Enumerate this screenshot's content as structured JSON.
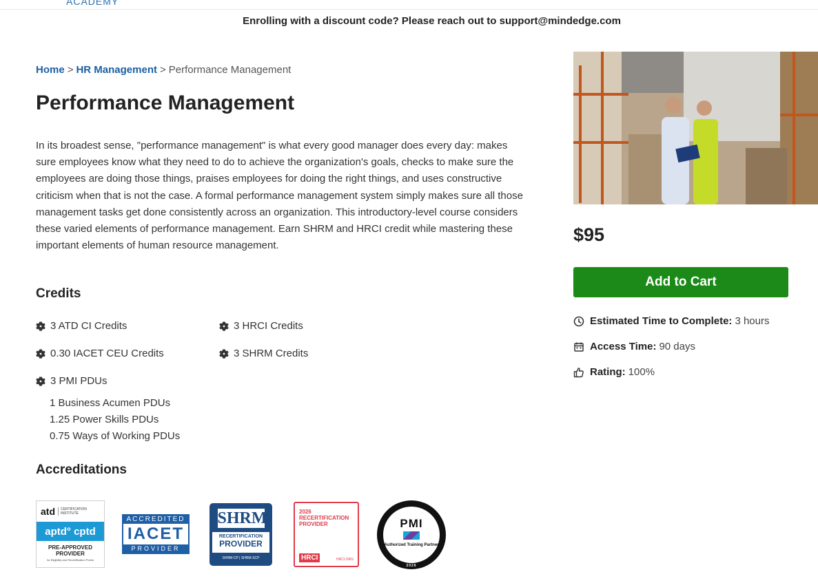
{
  "notice": "Enrolling with a discount code? Please reach out to support@mindedge.com",
  "breadcrumb": {
    "home": "Home",
    "separator": ">",
    "category": "HR Management",
    "current": "Performance Management"
  },
  "title": "Performance Management",
  "description": "In its broadest sense, \"performance management\" is what every good manager does every day: makes sure employees know what they need to do to achieve the organization's goals, checks to make sure the employees are doing those things, praises employees for doing the right things, and uses constructive criticism when that is not the case. A formal performance management system simply makes sure all those management tasks get done consistently across an organization. This introductory-level course considers these varied elements of performance management. Earn SHRM and HRCI credit while mastering these important elements of human resource management.",
  "credits": {
    "heading": "Credits",
    "items": [
      "3 ATD CI Credits",
      "3 HRCI Credits",
      "0.30 IACET CEU Credits",
      "3 SHRM Credits",
      "3 PMI PDUs"
    ],
    "pdu_breakdown": [
      "1 Business Acumen PDUs",
      "1.25 Power Skills PDUs",
      "0.75 Ways of Working PDUs"
    ]
  },
  "accreditations": {
    "heading": "Accreditations",
    "badges": {
      "atd": {
        "brand": "atd",
        "institute": "CERTIFICATION INSTITUTE",
        "marks": "aptd° cptd",
        "label": "PRE-APPROVED PROVIDER",
        "fine_print": "for Eligibility and Recertification Points"
      },
      "iacet": {
        "top": "ACCREDITED",
        "name": "IACET",
        "bottom": "PROVIDER"
      },
      "shrm": {
        "logo": "SHRM",
        "line1": "RECERTIFICATION",
        "line2": "PROVIDER",
        "foot": "SHRM-CP | SHRM-SCP"
      },
      "hrci": {
        "line1": "2026",
        "line2": "RECERTIFICATION",
        "line3": "PROVIDER",
        "brand": "HRCI",
        "url": "HRCI.ORG"
      },
      "pmi": {
        "logo": "PMI",
        "label": "Authorized Training Partner",
        "year": "2026"
      }
    }
  },
  "sidebar": {
    "price": "$95",
    "add_to_cart": "Add to Cart",
    "meta": [
      {
        "icon": "clock-icon",
        "label": "Estimated Time to Complete:",
        "value": "3 hours"
      },
      {
        "icon": "calendar-icon",
        "label": "Access Time:",
        "value": "90 days"
      },
      {
        "icon": "thumbs-up-icon",
        "label": "Rating:",
        "value": "100%"
      }
    ]
  },
  "colors": {
    "link": "#1b5fa3",
    "cart_button": "#1c8a18",
    "heading": "#222222"
  }
}
